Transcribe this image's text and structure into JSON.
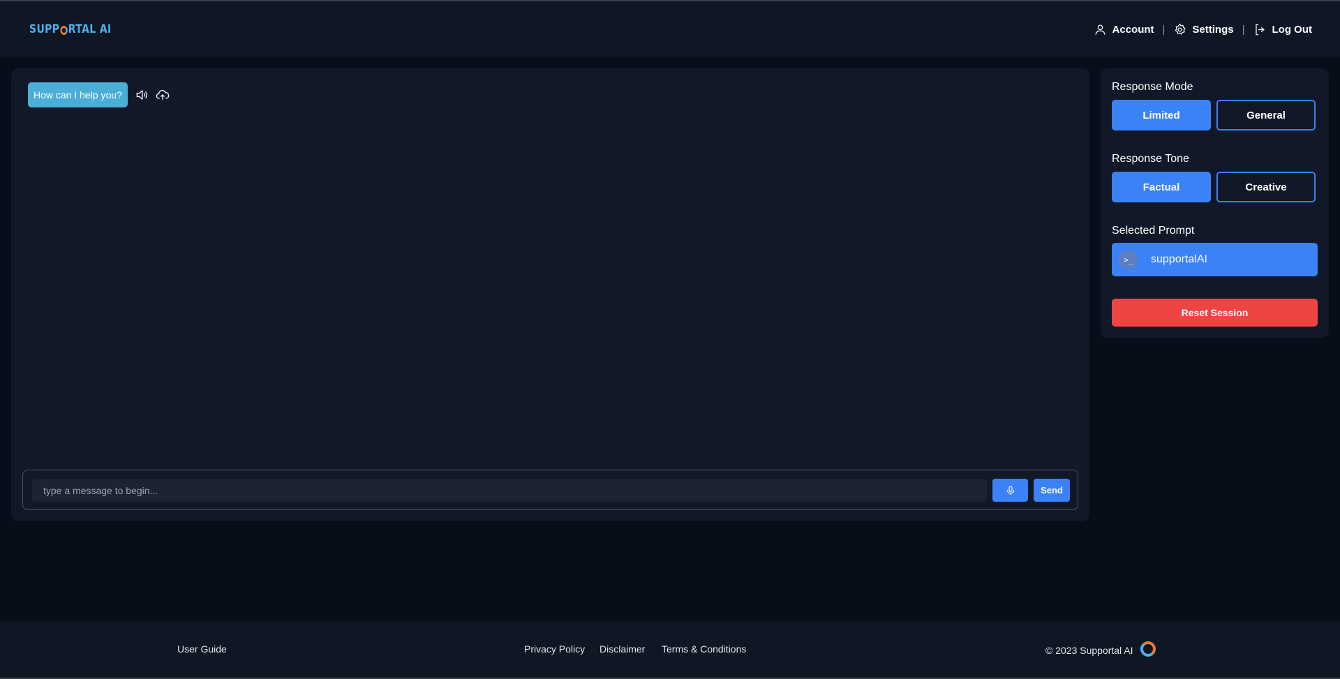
{
  "brand": {
    "logo_text_pre": "SUPP",
    "logo_text_post": "RTAL AI"
  },
  "nav": {
    "account": "Account",
    "separator": "|",
    "settings": "Settings",
    "logout": "Log Out"
  },
  "chat": {
    "greeting": "How can I help you?",
    "input_placeholder": "type a message to begin...",
    "input_value": "",
    "send_label": "Send"
  },
  "sidebar": {
    "response_mode": {
      "label": "Response Mode",
      "options": [
        "Limited",
        "General"
      ],
      "selected": "Limited"
    },
    "response_tone": {
      "label": "Response Tone",
      "options": [
        "Factual",
        "Creative"
      ],
      "selected": "Factual"
    },
    "selected_prompt": {
      "label": "Selected Prompt",
      "value": "supportalAI",
      "icon_text": ">_"
    },
    "reset_label": "Reset Session"
  },
  "footer": {
    "user_guide": "User Guide",
    "privacy": "Privacy Policy",
    "disclaimer": "Disclaimer",
    "terms": "Terms & Conditions",
    "copyright": "© 2023 Supportal AI"
  },
  "colors": {
    "accent": "#3b82f6",
    "danger": "#ef4444",
    "bubble": "#4aaed6",
    "background": "#070d19",
    "panel": "#111827"
  }
}
